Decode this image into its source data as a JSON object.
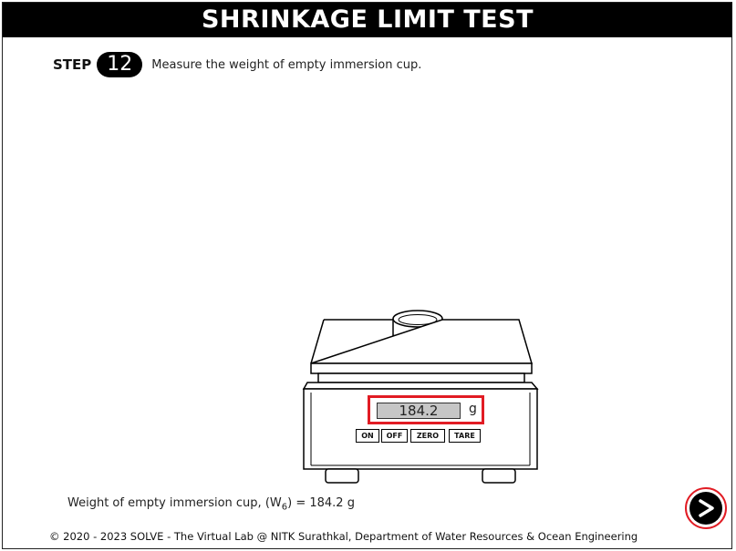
{
  "header": {
    "title": "SHRINKAGE LIMIT TEST"
  },
  "step": {
    "word": "STEP",
    "number": "12",
    "instruction": "Measure the weight of empty immersion cup."
  },
  "scale": {
    "reading": "184.2",
    "unit": "g",
    "buttons": {
      "on": "ON",
      "off": "OFF",
      "zero": "ZERO",
      "tare": "TARE"
    }
  },
  "result": {
    "label_prefix": "Weight of empty immersion cup, (W",
    "subscript": "6",
    "label_suffix": ") = 184.2 g"
  },
  "footer": {
    "text": "© 2020 - 2023 SOLVE - The Virtual Lab @ NITK Surathkal, Department of Water Resources & Ocean Engineering"
  },
  "colors": {
    "accent": "#e11c24",
    "header_bg": "#000000",
    "display_bg": "#c6c6c6"
  },
  "icons": {
    "next": "next-arrow-icon"
  }
}
